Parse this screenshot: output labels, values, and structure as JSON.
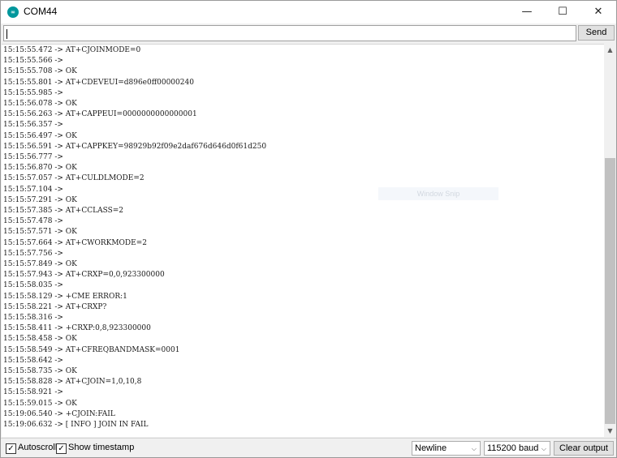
{
  "window": {
    "title": "COM44",
    "app_icon_text": "∞",
    "minimize_symbol": "—",
    "maximize_symbol": "☐",
    "close_symbol": "✕"
  },
  "input": {
    "value": "",
    "placeholder": ""
  },
  "send_label": "Send",
  "watermark": "Window Snip",
  "output_lines": [
    "15:15:55.472 -> AT+CJOINMODE=0",
    "15:15:55.566 -> ",
    "15:15:55.708 -> OK",
    "15:15:55.801 -> AT+CDEVEUI=d896e0ff00000240",
    "15:15:55.985 -> ",
    "15:15:56.078 -> OK",
    "15:15:56.263 -> AT+CAPPEUI=0000000000000001",
    "15:15:56.357 -> ",
    "15:15:56.497 -> OK",
    "15:15:56.591 -> AT+CAPPKEY=98929b92f09e2daf676d646d0f61d250",
    "15:15:56.777 -> ",
    "15:15:56.870 -> OK",
    "15:15:57.057 -> AT+CULDLMODE=2",
    "15:15:57.104 -> ",
    "15:15:57.291 -> OK",
    "15:15:57.385 -> AT+CCLASS=2",
    "15:15:57.478 -> ",
    "15:15:57.571 -> OK",
    "15:15:57.664 -> AT+CWORKMODE=2",
    "15:15:57.756 -> ",
    "15:15:57.849 -> OK",
    "15:15:57.943 -> AT+CRXP=0,0,923300000",
    "15:15:58.035 -> ",
    "15:15:58.129 -> +CME ERROR:1",
    "15:15:58.221 -> AT+CRXP?",
    "15:15:58.316 -> ",
    "15:15:58.411 -> +CRXP:0,8,923300000",
    "15:15:58.458 -> OK",
    "15:15:58.549 -> AT+CFREQBANDMASK=0001",
    "15:15:58.642 -> ",
    "15:15:58.735 -> OK",
    "15:15:58.828 -> AT+CJOIN=1,0,10,8",
    "15:15:58.921 -> ",
    "15:15:59.015 -> OK",
    "15:19:06.540 -> +CJOIN:FAIL",
    "15:19:06.632 -> [ INFO ] JOIN IN FAIL"
  ],
  "scrollbar": {
    "up_arrow": "▲",
    "down_arrow": "▼"
  },
  "footer": {
    "autoscroll_label": "Autoscroll",
    "autoscroll_checked": true,
    "timestamp_label": "Show timestamp",
    "timestamp_checked": true,
    "check_mark": "✓",
    "line_ending": "Newline",
    "baud_rate": "115200 baud",
    "dropdown_arrow": "⌵",
    "clear_label": "Clear output"
  }
}
